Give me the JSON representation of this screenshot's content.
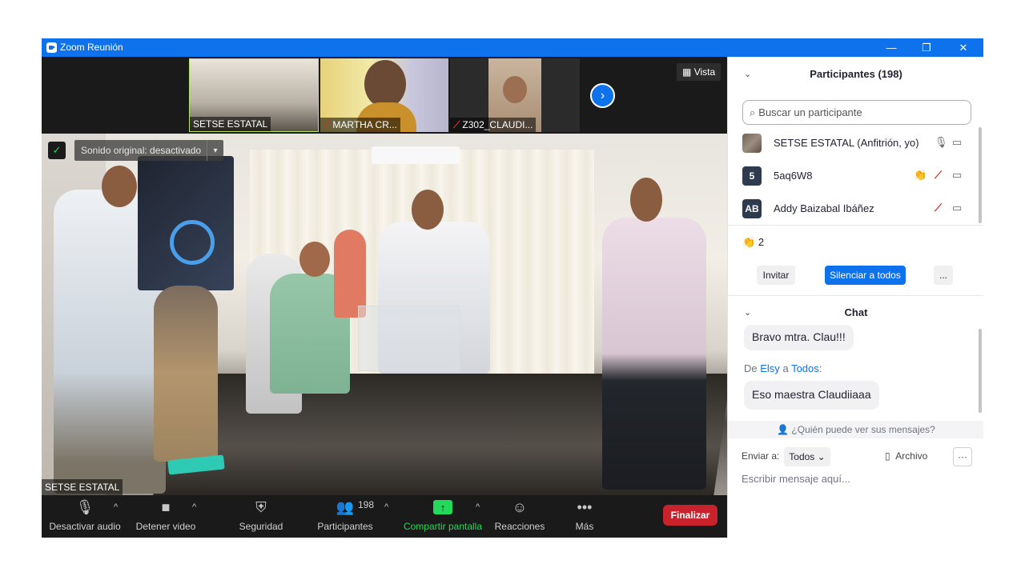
{
  "window": {
    "title": "Zoom Reunión",
    "minimize": "—",
    "restore": "❐",
    "close": "✕"
  },
  "strip": {
    "thumbnails": [
      {
        "name": "SETSE ESTATAL"
      },
      {
        "name": "MARTHA CR..."
      },
      {
        "name": "Z302_CLAUDI..."
      }
    ],
    "mute_icon": "⟋",
    "view_icon": "▦",
    "view_label": "Vista",
    "next_icon": "›"
  },
  "main_video": {
    "sound_label": "Sonido original: desactivado",
    "sound_chevron": "▾",
    "shield_icon": "✓",
    "speaker_name": "SETSE ESTATAL"
  },
  "toolbar": {
    "audio_icon": "🎙",
    "audio_label": "Desactivar audio",
    "video_icon": "■",
    "video_label": "Detener video",
    "security_icon": "⛨",
    "security_label": "Seguridad",
    "participants_icon": "👥",
    "participants_label": "Participantes",
    "participants_count": "198",
    "share_icon": "↑",
    "share_label": "Compartir pantalla",
    "reactions_icon": "☺",
    "reactions_label": "Reacciones",
    "more_icon": "•••",
    "more_label": "Más",
    "caret": "^",
    "end_label": "Finalizar"
  },
  "participants": {
    "header": "Participantes (198)",
    "collapse_icon": "⌄",
    "search_icon": "⌕",
    "search_placeholder": "Buscar un participante",
    "list": [
      {
        "avatar": "",
        "name": "SETSE ESTATAL (Anfitrión, yo)",
        "clap": "",
        "mic": "🎙",
        "cam": "▭"
      },
      {
        "avatar": "5",
        "name": "5aq6W8",
        "clap": "👏",
        "mic": "⟋",
        "cam": "▭"
      },
      {
        "avatar": "AB",
        "name": "Addy Baizabal Ibáñez",
        "clap": "",
        "mic": "⟋",
        "cam": "▭"
      }
    ],
    "reaction_icon": "👏",
    "reaction_count": "2",
    "invite_label": "Invitar",
    "mute_all_label": "Silenciar a todos",
    "more_label": "..."
  },
  "chat": {
    "header": "Chat",
    "collapse_icon": "⌄",
    "messages": [
      {
        "text": "Bravo mtra. Clau!!!"
      },
      {
        "text": "Eso maestra Claudiiaaa"
      }
    ],
    "from_prefix": "De",
    "from_sender": "Elsy",
    "from_middle": "a",
    "from_target": "Todos",
    "from_suffix": ":",
    "who_icon": "👤",
    "who_can_see": "¿Quién puede ver sus mensajes?",
    "send_to_label": "Enviar a:",
    "send_to_value": "Todos",
    "send_to_chevron": "⌄",
    "file_icon": "▯",
    "file_label": "Archivo",
    "more_icon": "···",
    "input_placeholder": "Escribir mensaje aquí..."
  },
  "colors": {
    "accent": "#0e72ed",
    "end": "#c8232c",
    "share": "#23d959",
    "mute": "#e02828"
  }
}
